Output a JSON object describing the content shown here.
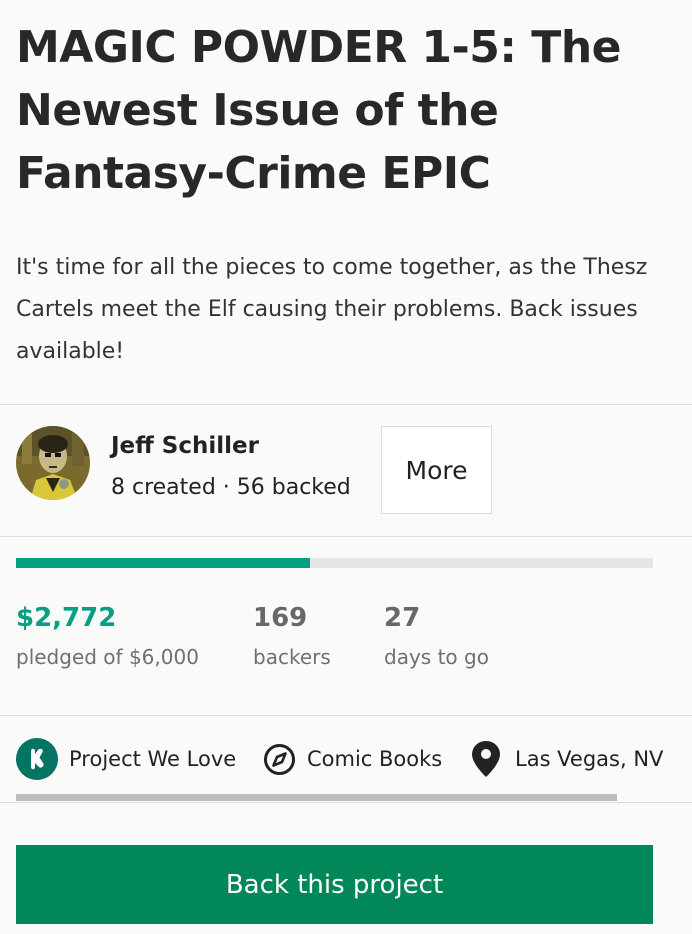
{
  "project": {
    "title": "MAGIC POWDER 1-5: The Newest Issue of the Fantasy-Crime EPIC",
    "blurb": "It's time for all the pieces to come together, as the Thesz Cartels meet the Elf causing their problems. Back issues available!"
  },
  "creator": {
    "name": "Jeff Schiller",
    "stats": "8 created · 56 backed",
    "more_label": "More"
  },
  "funding": {
    "progress_fraction": 0.462,
    "pledged_value": "$2,772",
    "pledged_label": "pledged of $6,000",
    "backers_value": "169",
    "backers_label": "backers",
    "days_value": "27",
    "days_label": "days to go"
  },
  "tags": [
    {
      "label": "Project We Love",
      "icon": "kickstarter-badge-icon"
    },
    {
      "label": "Comic Books",
      "icon": "compass-icon"
    },
    {
      "label": "Las Vegas, NV",
      "icon": "location-pin-icon"
    }
  ],
  "cta": {
    "back_label": "Back this project"
  },
  "colors": {
    "accent_green": "#05a081",
    "button_green": "#028858",
    "badge_green": "#037362"
  }
}
